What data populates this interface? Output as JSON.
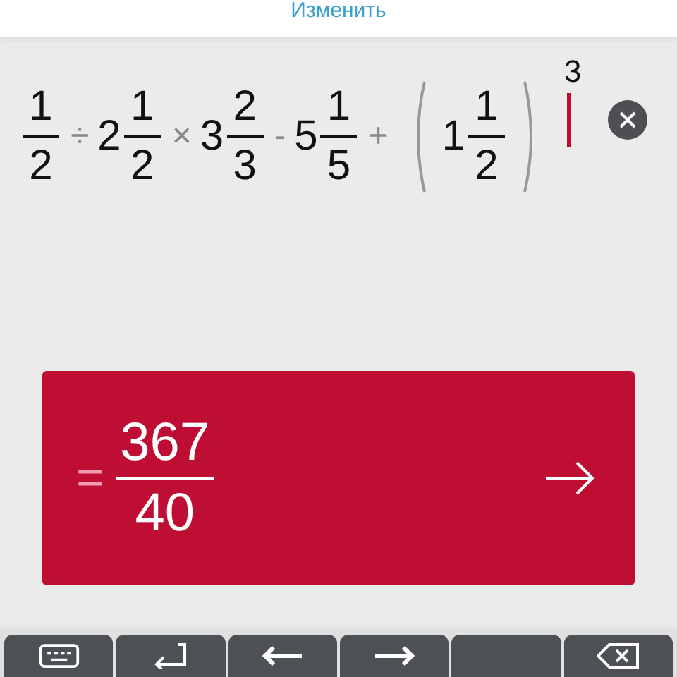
{
  "header": {
    "link": "Изменить"
  },
  "expression": [
    {
      "kind": "fraction",
      "num": "1",
      "den": "2"
    },
    {
      "kind": "op",
      "text": "÷"
    },
    {
      "kind": "mixed",
      "whole": "2",
      "num": "1",
      "den": "2"
    },
    {
      "kind": "op",
      "text": "×"
    },
    {
      "kind": "mixed",
      "whole": "3",
      "num": "2",
      "den": "3"
    },
    {
      "kind": "op",
      "text": "-"
    },
    {
      "kind": "mixed",
      "whole": "5",
      "num": "1",
      "den": "5"
    },
    {
      "kind": "op",
      "text": "+"
    },
    {
      "kind": "paren_open"
    },
    {
      "kind": "mixed",
      "whole": "1",
      "num": "1",
      "den": "2"
    },
    {
      "kind": "paren_close"
    },
    {
      "kind": "power",
      "text": "3"
    },
    {
      "kind": "cursor"
    }
  ],
  "result": {
    "sign": "=",
    "num": "367",
    "den": "40"
  },
  "keys": [
    {
      "kind": "keyboard"
    },
    {
      "kind": "enter"
    },
    {
      "kind": "left"
    },
    {
      "kind": "right"
    },
    {
      "kind": "blank"
    },
    {
      "kind": "backspace"
    }
  ]
}
